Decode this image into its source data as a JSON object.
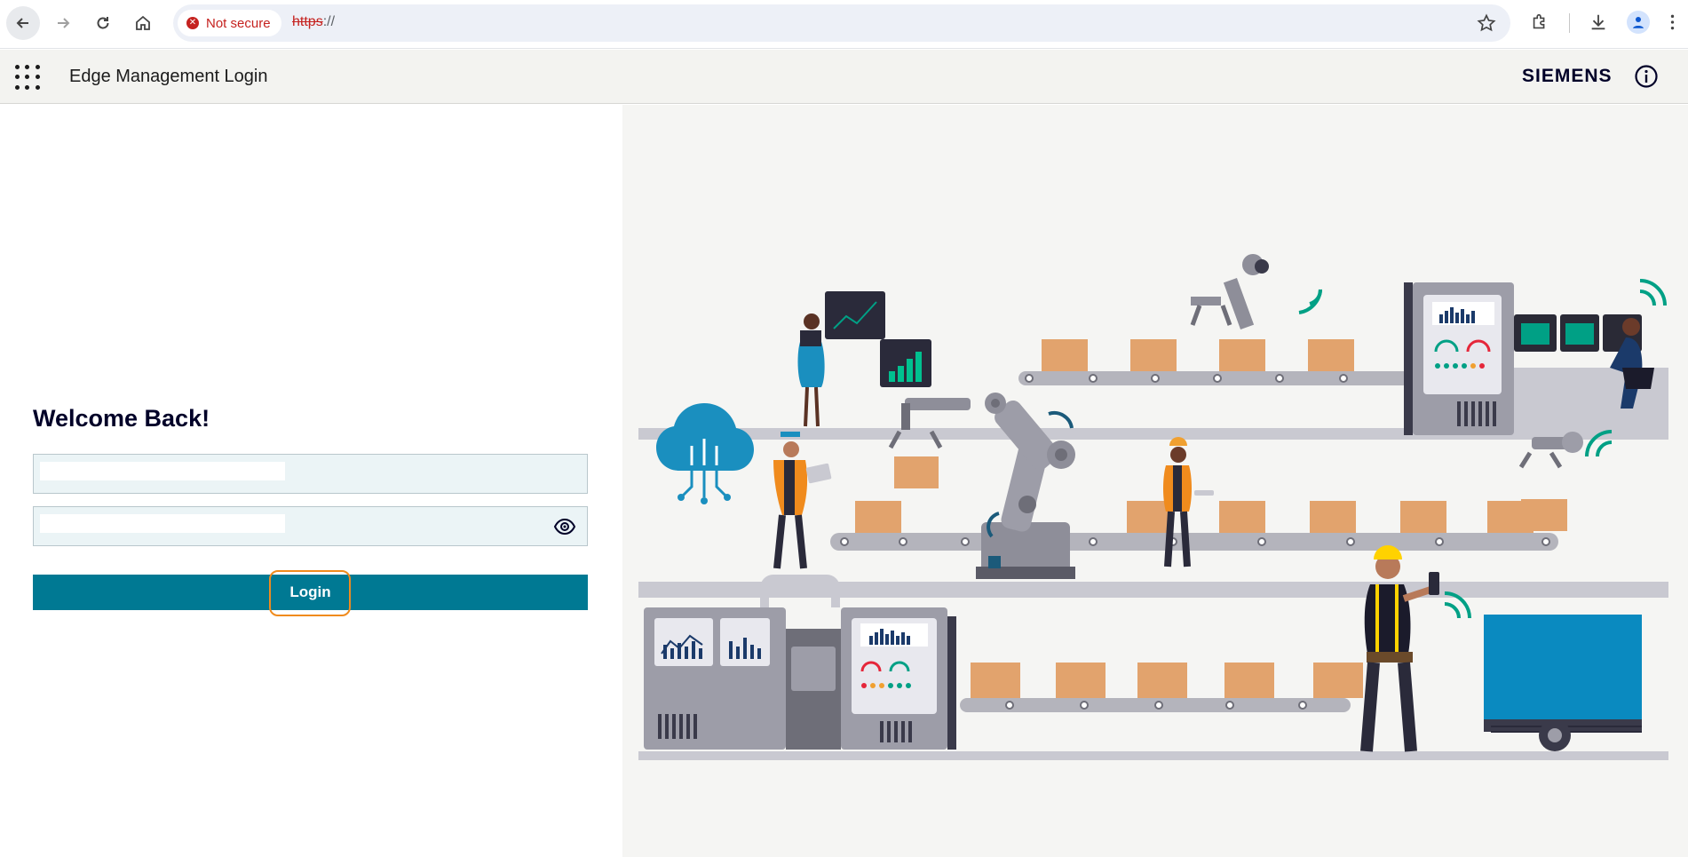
{
  "browser": {
    "security_label": "Not secure",
    "url_scheme": "https",
    "url_rest": "://",
    "icons": [
      "back-icon",
      "forward-icon",
      "reload-icon",
      "home-icon",
      "star-icon",
      "extensions-icon",
      "download-icon",
      "profile-icon",
      "menu-icon"
    ]
  },
  "header": {
    "title": "Edge Management Login",
    "brand": "SIEMENS"
  },
  "login": {
    "heading": "Welcome Back!",
    "username_value": "",
    "password_value": "",
    "button_label": "Login"
  },
  "colors": {
    "accent": "#007993",
    "focus_ring": "#f08b1d",
    "brand_text": "#000028",
    "field_bg": "#ebf4f6"
  }
}
